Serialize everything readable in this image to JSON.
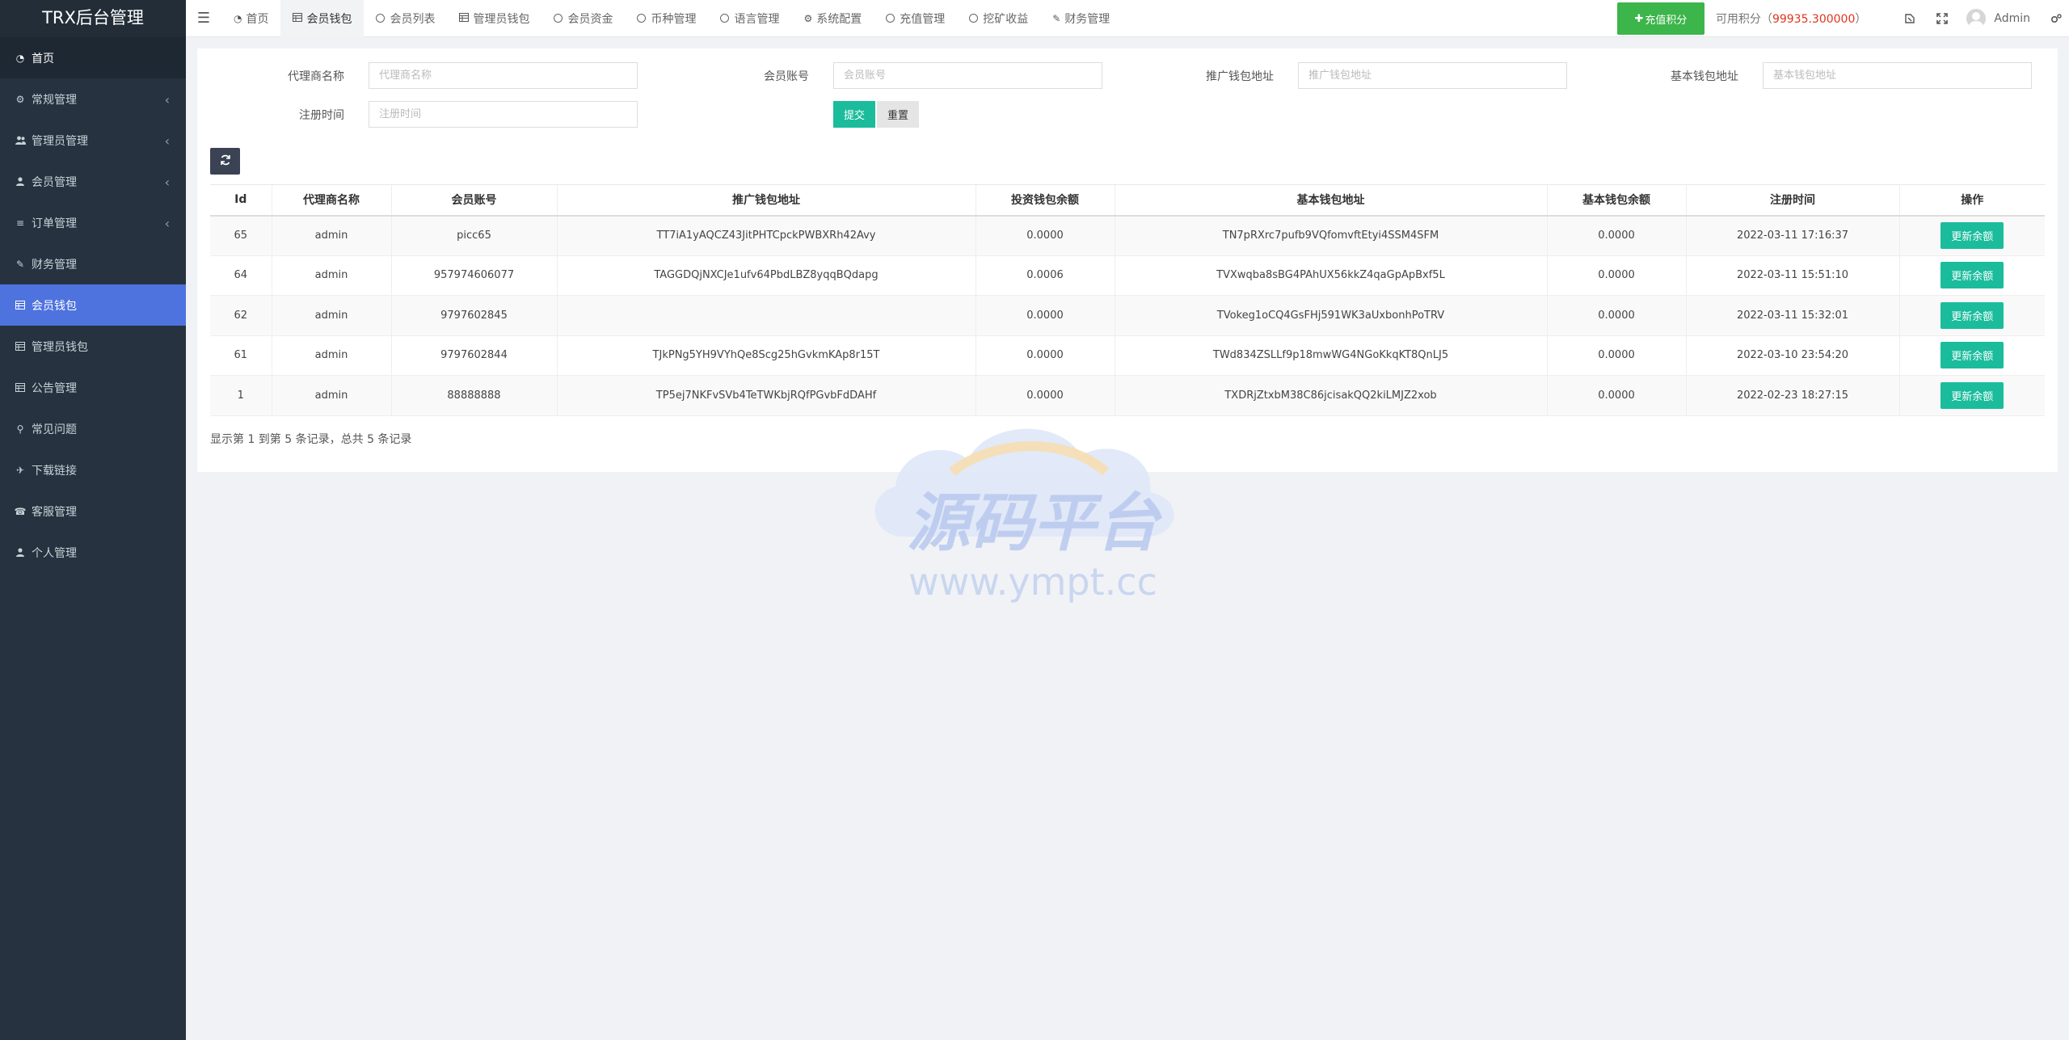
{
  "app": {
    "title": "TRX后台管理"
  },
  "sidebar": {
    "items": [
      {
        "label": "首页",
        "icon": "dashboard-icon",
        "caret": false
      },
      {
        "label": "常规管理",
        "icon": "cogs-icon",
        "caret": true
      },
      {
        "label": "管理员管理",
        "icon": "users-icon",
        "caret": true
      },
      {
        "label": "会员管理",
        "icon": "user-icon",
        "caret": true
      },
      {
        "label": "订单管理",
        "icon": "list-icon",
        "caret": true
      },
      {
        "label": "财务管理",
        "icon": "edit-icon",
        "caret": false
      },
      {
        "label": "会员钱包",
        "icon": "table-icon",
        "caret": false
      },
      {
        "label": "管理员钱包",
        "icon": "table-icon",
        "caret": false
      },
      {
        "label": "公告管理",
        "icon": "table-icon",
        "caret": false
      },
      {
        "label": "常见问题",
        "icon": "search-icon",
        "caret": false
      },
      {
        "label": "下载链接",
        "icon": "plane-icon",
        "caret": false
      },
      {
        "label": "客服管理",
        "icon": "phone-icon",
        "caret": false
      },
      {
        "label": "个人管理",
        "icon": "user-icon",
        "caret": false
      }
    ]
  },
  "topbar": {
    "tabs": [
      {
        "label": "首页",
        "icon": "dashboard-icon"
      },
      {
        "label": "会员钱包",
        "icon": "table-icon"
      },
      {
        "label": "会员列表",
        "icon": "circle-icon"
      },
      {
        "label": "管理员钱包",
        "icon": "table-icon"
      },
      {
        "label": "会员资金",
        "icon": "circle-icon"
      },
      {
        "label": "币种管理",
        "icon": "circle-icon"
      },
      {
        "label": "语言管理",
        "icon": "circle-icon"
      },
      {
        "label": "系统配置",
        "icon": "gear-icon"
      },
      {
        "label": "充值管理",
        "icon": "circle-icon"
      },
      {
        "label": "挖矿收益",
        "icon": "circle-icon"
      },
      {
        "label": "财务管理",
        "icon": "edit-icon"
      }
    ],
    "recharge_label": "充值积分",
    "points_label": "可用积分（",
    "points_value": "99935.300000",
    "points_suffix": "）",
    "user": "Admin"
  },
  "filters": {
    "agent_label": "代理商名称",
    "agent_placeholder": "代理商名称",
    "account_label": "会员账号",
    "account_placeholder": "会员账号",
    "promo_label": "推广钱包地址",
    "promo_placeholder": "推广钱包地址",
    "base_label": "基本钱包地址",
    "base_placeholder": "基本钱包地址",
    "reg_label": "注册时间",
    "reg_placeholder": "注册时间",
    "submit": "提交",
    "reset": "重置"
  },
  "table": {
    "headers": [
      "Id",
      "代理商名称",
      "会员账号",
      "推广钱包地址",
      "投资钱包余额",
      "基本钱包地址",
      "基本钱包余额",
      "注册时间",
      "操作"
    ],
    "rows": [
      {
        "id": "65",
        "agent": "admin",
        "account": "picc65",
        "promo": "TT7iA1yAQCZ43JitPHTCpckPWBXRh42Avy",
        "invest": "0.0000",
        "base": "TN7pRXrc7pufb9VQfomvftEtyi4SSM4SFM",
        "base_balance": "0.0000",
        "time": "2022-03-11 17:16:37",
        "action": "更新余额"
      },
      {
        "id": "64",
        "agent": "admin",
        "account": "957974606077",
        "promo": "TAGGDQjNXCJe1ufv64PbdLBZ8yqqBQdapg",
        "invest": "0.0006",
        "base": "TVXwqba8sBG4PAhUX56kkZ4qaGpApBxf5L",
        "base_balance": "0.0000",
        "time": "2022-03-11 15:51:10",
        "action": "更新余额"
      },
      {
        "id": "62",
        "agent": "admin",
        "account": "9797602845",
        "promo": "",
        "invest": "0.0000",
        "base": "TVokeg1oCQ4GsFHj591WK3aUxbonhPoTRV",
        "base_balance": "0.0000",
        "time": "2022-03-11 15:32:01",
        "action": "更新余额"
      },
      {
        "id": "61",
        "agent": "admin",
        "account": "9797602844",
        "promo": "TJkPNg5YH9VYhQe8Scg25hGvkmKAp8r15T",
        "invest": "0.0000",
        "base": "TWd834ZSLLf9p18mwWG4NGoKkqKT8QnLJ5",
        "base_balance": "0.0000",
        "time": "2022-03-10 23:54:20",
        "action": "更新余额"
      },
      {
        "id": "1",
        "agent": "admin",
        "account": "88888888",
        "promo": "TP5ej7NKFvSVb4TeTWKbjRQfPGvbFdDAHf",
        "invest": "0.0000",
        "base": "TXDRjZtxbM38C86jcisakQQ2kiLMJZ2xob",
        "base_balance": "0.0000",
        "time": "2022-02-23 18:27:15",
        "action": "更新余额"
      }
    ],
    "summary": "显示第 1 到第 5 条记录，总共 5 条记录"
  },
  "watermark": {
    "title": "源码平台",
    "url": "www.ympt.cc"
  },
  "colors": {
    "sidebar_bg": "#263240",
    "active_menu": "#4e73df",
    "teal": "#1abc9c",
    "recharge": "#3cb54a",
    "points": "#e0341f"
  }
}
